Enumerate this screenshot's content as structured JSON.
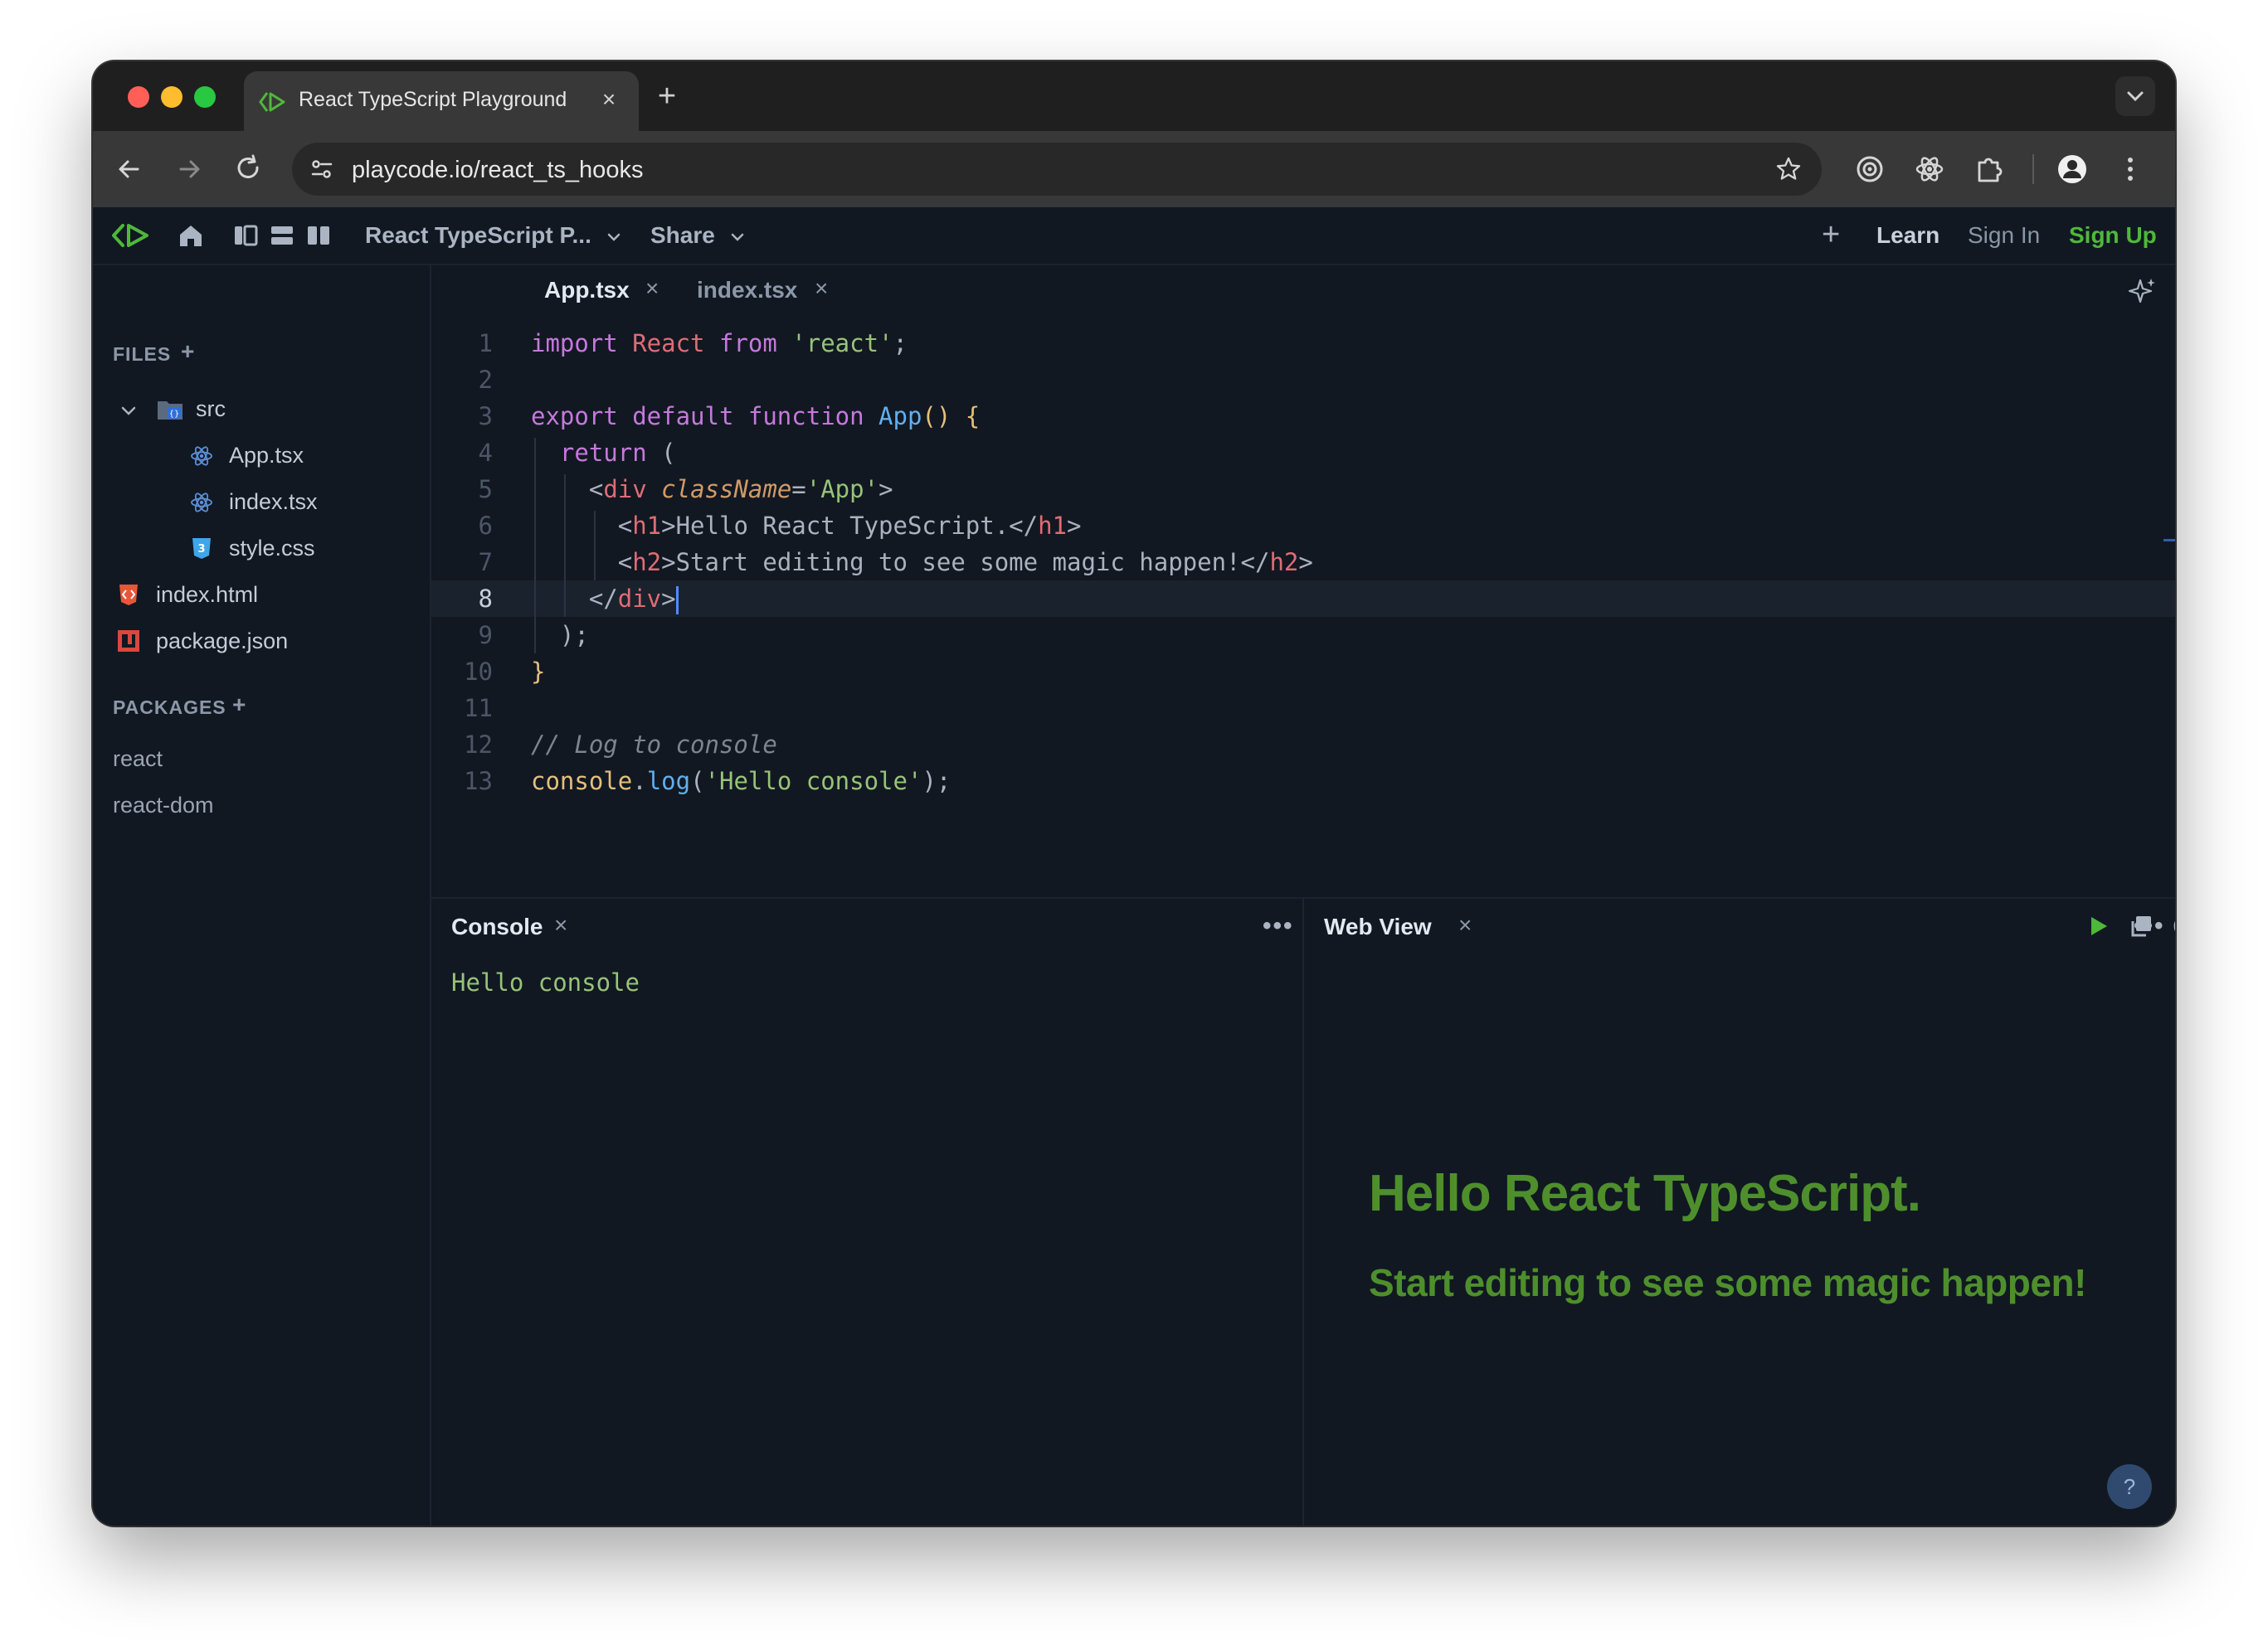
{
  "browser": {
    "tab_title": "React TypeScript Playground",
    "tab_close": "×",
    "new_tab": "+",
    "url": "playcode.io/react_ts_hooks"
  },
  "app": {
    "project_name": "React TypeScript P...",
    "share_label": "Share",
    "plus_label": "+",
    "learn_label": "Learn",
    "signin_label": "Sign In",
    "signup_label": "Sign Up",
    "signup_color": "#4fb83a"
  },
  "sidebar": {
    "files_title": "FILES",
    "packages_title": "PACKAGES",
    "add_symbol": "+",
    "folder": "src",
    "files": [
      "App.tsx",
      "index.tsx",
      "style.css",
      "index.html",
      "package.json"
    ],
    "packages": [
      "react",
      "react-dom"
    ]
  },
  "editor": {
    "tabs": [
      {
        "label": "App.tsx",
        "active": true
      },
      {
        "label": "index.tsx",
        "active": false
      }
    ],
    "close_symbol": "×",
    "current_line": 8,
    "lines": [
      {
        "n": "1",
        "segments": [
          [
            "k",
            "import "
          ],
          [
            "r",
            "React "
          ],
          [
            "k",
            "from "
          ],
          [
            "s",
            "'react'"
          ],
          [
            "pl",
            ";"
          ]
        ]
      },
      {
        "n": "2",
        "segments": []
      },
      {
        "n": "3",
        "segments": [
          [
            "k",
            "export default function "
          ],
          [
            "f",
            "App"
          ],
          [
            "y",
            "() {"
          ]
        ]
      },
      {
        "n": "4",
        "segments": [
          [
            "pl",
            "  "
          ],
          [
            "k",
            "return "
          ],
          [
            "pl",
            "("
          ]
        ]
      },
      {
        "n": "5",
        "segments": [
          [
            "pl",
            "    <"
          ],
          [
            "tg",
            "div "
          ],
          [
            "at",
            "className"
          ],
          [
            "pl",
            "="
          ],
          [
            "s",
            "'App'"
          ],
          [
            "pl",
            ">"
          ]
        ]
      },
      {
        "n": "6",
        "segments": [
          [
            "pl",
            "      <"
          ],
          [
            "tg",
            "h1"
          ],
          [
            "pl",
            ">Hello React TypeScript.</"
          ],
          [
            "tg",
            "h1"
          ],
          [
            "pl",
            ">"
          ]
        ]
      },
      {
        "n": "7",
        "segments": [
          [
            "pl",
            "      <"
          ],
          [
            "tg",
            "h2"
          ],
          [
            "pl",
            ">Start editing to see some magic happen!</"
          ],
          [
            "tg",
            "h2"
          ],
          [
            "pl",
            ">"
          ]
        ]
      },
      {
        "n": "8",
        "segments": [
          [
            "pl",
            "    </"
          ],
          [
            "tg",
            "div"
          ],
          [
            "pl",
            ">"
          ]
        ]
      },
      {
        "n": "9",
        "segments": [
          [
            "pl",
            "  );"
          ]
        ]
      },
      {
        "n": "10",
        "segments": [
          [
            "y",
            "}"
          ]
        ]
      },
      {
        "n": "11",
        "segments": []
      },
      {
        "n": "12",
        "segments": [
          [
            "c",
            "// Log to console"
          ]
        ]
      },
      {
        "n": "13",
        "segments": [
          [
            "y",
            "console"
          ],
          [
            "pl",
            "."
          ],
          [
            "f",
            "log"
          ],
          [
            "pl",
            "("
          ],
          [
            "s",
            "'Hello console'"
          ],
          [
            "pl",
            ");"
          ]
        ]
      }
    ]
  },
  "console": {
    "title": "Console",
    "close_symbol": "×",
    "menu_symbol": "•••",
    "output": "Hello console"
  },
  "webview": {
    "title": "Web View",
    "close_symbol": "×",
    "menu_symbol": "•••",
    "heading1": "Hello React TypeScript.",
    "heading2": "Start editing to see some magic happen!",
    "help_symbol": "?"
  }
}
